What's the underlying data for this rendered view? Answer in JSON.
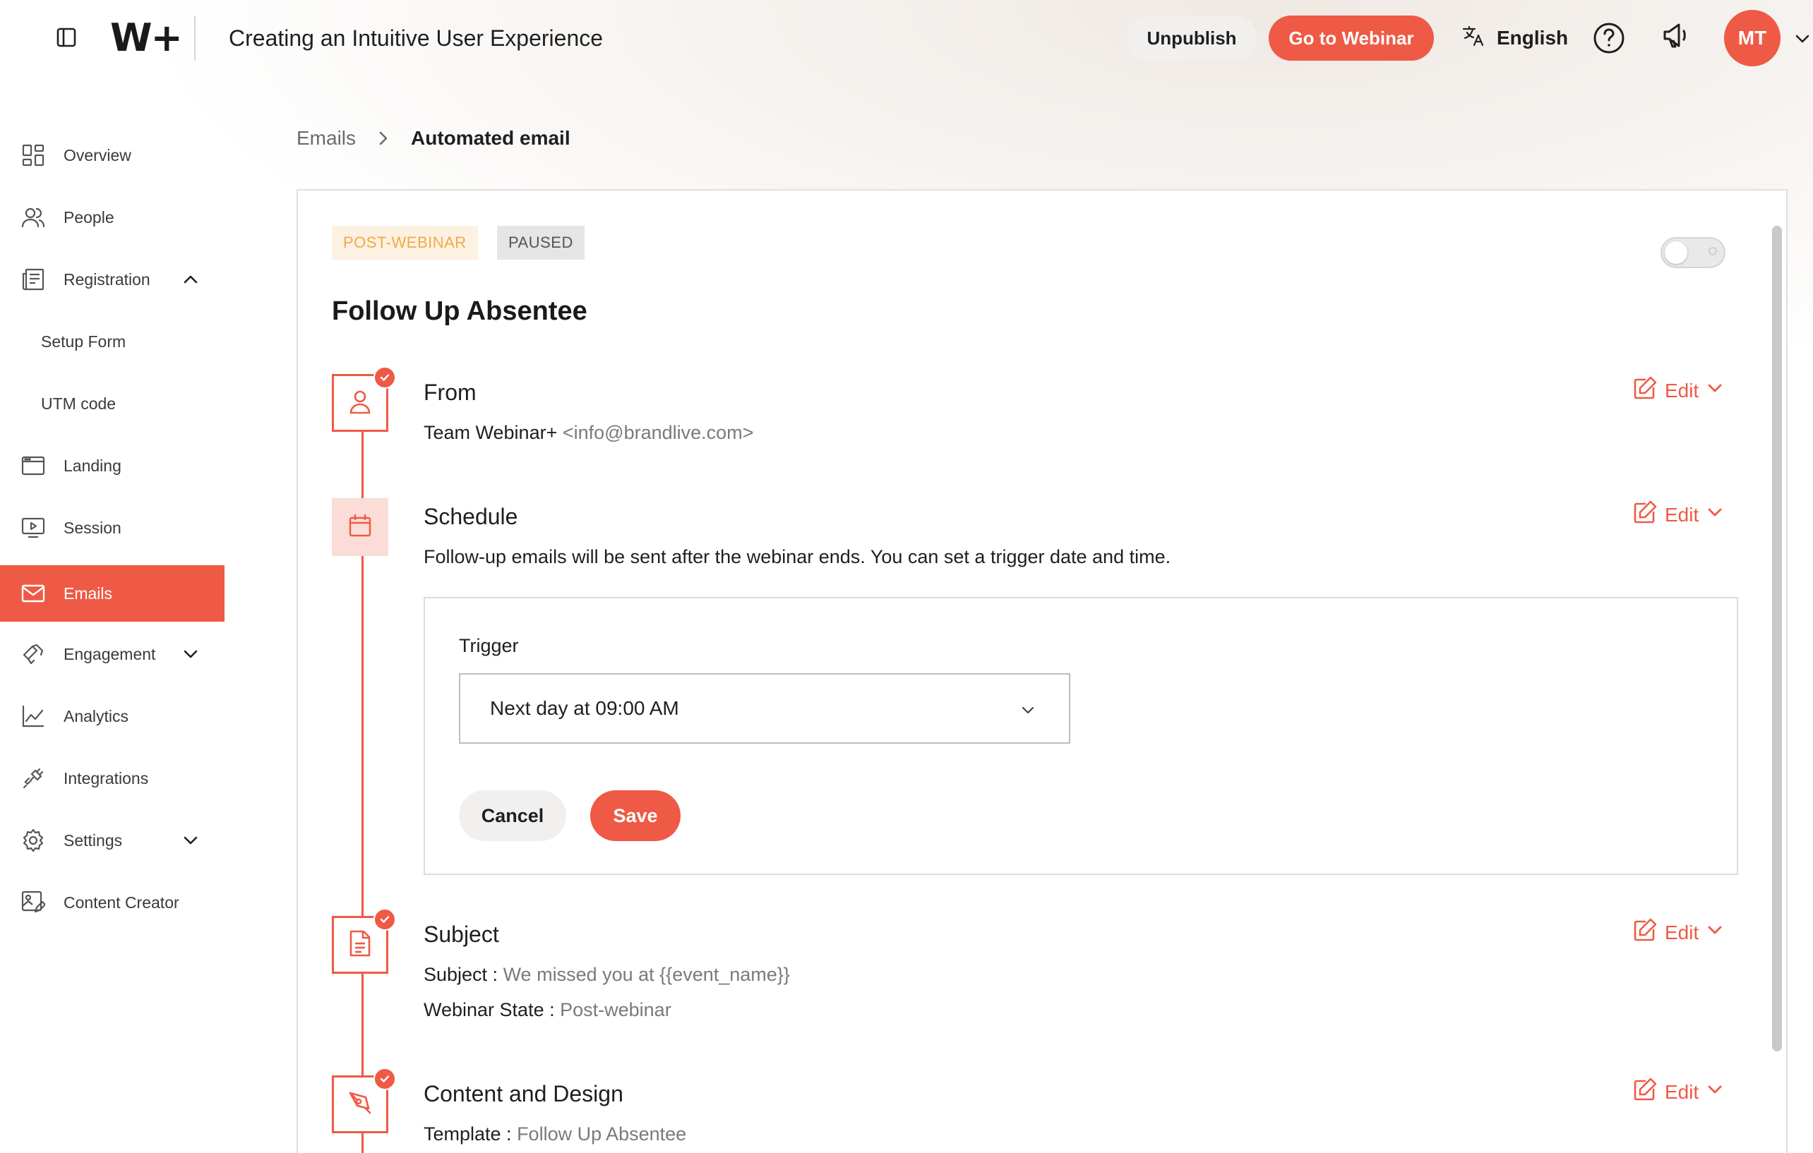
{
  "header": {
    "logo": "W+",
    "title": "Creating an Intuitive User Experience",
    "unpublish_label": "Unpublish",
    "go_label": "Go to Webinar",
    "language": "English",
    "avatar_initials": "MT"
  },
  "sidebar": {
    "items": [
      {
        "label": "Overview",
        "icon": "grid-icon"
      },
      {
        "label": "People",
        "icon": "people-icon"
      },
      {
        "label": "Registration",
        "icon": "registration-icon",
        "expanded": true
      },
      {
        "label": "Setup Form"
      },
      {
        "label": "UTM code"
      },
      {
        "label": "Landing",
        "icon": "browser-icon"
      },
      {
        "label": "Session",
        "icon": "play-screen-icon"
      },
      {
        "label": "Emails",
        "icon": "mail-icon",
        "active": true
      },
      {
        "label": "Engagement",
        "icon": "engagement-icon",
        "expanded": false
      },
      {
        "label": "Analytics",
        "icon": "chart-icon"
      },
      {
        "label": "Integrations",
        "icon": "plug-icon"
      },
      {
        "label": "Settings",
        "icon": "gear-icon",
        "expanded": false
      },
      {
        "label": "Content Creator",
        "icon": "image-edit-icon"
      }
    ]
  },
  "breadcrumb": {
    "parent": "Emails",
    "current": "Automated email"
  },
  "email": {
    "badge_phase": "POST-WEBINAR",
    "badge_status": "PAUSED",
    "enabled": false,
    "title": "Follow Up Absentee",
    "edit_label": "Edit",
    "from": {
      "title": "From",
      "name": "Team Webinar+",
      "address": "<info@brandlive.com>"
    },
    "schedule": {
      "title": "Schedule",
      "description": "Follow-up emails will be sent after the webinar ends. You can set a trigger date and time.",
      "trigger_label": "Trigger",
      "trigger_value": "Next day at 09:00 AM",
      "cancel_label": "Cancel",
      "save_label": "Save"
    },
    "subject": {
      "title": "Subject",
      "subject_key": "Subject : ",
      "subject_value": "We missed you at {{event_name}}",
      "state_key": "Webinar State : ",
      "state_value": "Post-webinar"
    },
    "content": {
      "title": "Content and Design",
      "template_key": "Template : ",
      "template_value": "Follow Up Absentee"
    }
  },
  "colors": {
    "accent": "#ee5a45",
    "badge_post_bg": "#fdf1e1",
    "badge_post_text": "#f2a948",
    "active_step_bg": "#fbdcd6"
  }
}
